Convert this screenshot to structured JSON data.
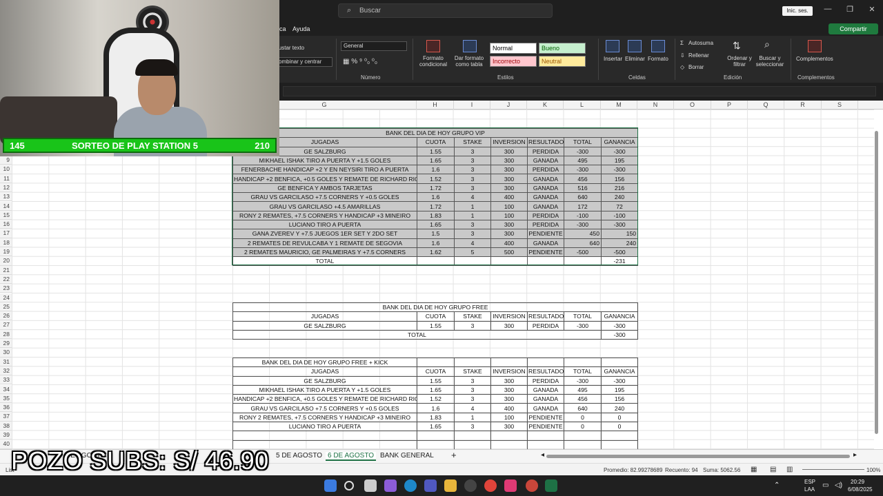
{
  "titlebar": {
    "search_placeholder": "Buscar",
    "signin": "Inic. ses."
  },
  "menu": {
    "partial": "ca",
    "help": "Ayuda",
    "share": "Compartir"
  },
  "ribbon": {
    "adjust_text": "justar texto",
    "merge": "ombinar y centrar",
    "number_format": "General",
    "group_number": "Número",
    "cond_format": "Formato\ncondicional",
    "format_table": "Dar formato\ncomo tabla",
    "styles": {
      "normal": "Normal",
      "good": "Bueno",
      "bad": "Incorrecto",
      "neutral": "Neutral"
    },
    "group_styles": "Estilos",
    "insert": "Insertar",
    "delete": "Eliminar",
    "format": "Formato",
    "group_cells": "Celdas",
    "autosum": "Autosuma",
    "fill": "Rellenar",
    "clear": "Borrar",
    "sort": "Ordenar y filtrar",
    "find": "Buscar y seleccionar",
    "group_edit": "Edición",
    "addins": "Complementos",
    "group_addins": "Complementos"
  },
  "columns": [
    "G",
    "H",
    "I",
    "J",
    "K",
    "L",
    "M",
    "N",
    "O",
    "P",
    "Q",
    "R",
    "S"
  ],
  "rows": [
    "9",
    "10",
    "11",
    "12",
    "13",
    "14",
    "15",
    "16",
    "17",
    "18",
    "19",
    "20",
    "21",
    "22",
    "23",
    "24",
    "25",
    "26",
    "27",
    "28",
    "29",
    "30",
    "31",
    "32",
    "33",
    "34",
    "35",
    "36",
    "37",
    "38",
    "39",
    "40"
  ],
  "vip": {
    "title": "BANK DEL DIA DE HOY GRUPO VIP",
    "headers": [
      "JUGADAS",
      "CUOTA",
      "STAKE",
      "INVERSION",
      "RESULTADO",
      "TOTAL",
      "GANANCIA"
    ],
    "rows": [
      [
        "GE SALZBURG",
        "1.55",
        "3",
        "300",
        "PERDIDA",
        "-300",
        "-300"
      ],
      [
        "MIKHAEL ISHAK TIRO A PUERTA Y +1.5 GOLES",
        "1.65",
        "3",
        "300",
        "GANADA",
        "495",
        "195"
      ],
      [
        "FENERBACHE HANDICAP +2 Y EN NEYSIRI TIRO A PUERTA",
        "1.6",
        "3",
        "300",
        "PERDIDA",
        "-300",
        "-300"
      ],
      [
        "HANDICAP +2 BENFICA, +0.5 GOLES Y REMATE DE RICHARD RIOS",
        "1.52",
        "3",
        "300",
        "GANADA",
        "456",
        "156"
      ],
      [
        "GE BENFICA Y AMBOS TARJETAS",
        "1.72",
        "3",
        "300",
        "GANADA",
        "516",
        "216"
      ],
      [
        "GRAU VS GARCILASO +7.5 CORNERS Y +0.5 GOLES",
        "1.6",
        "4",
        "400",
        "GANADA",
        "640",
        "240"
      ],
      [
        "GRAU VS GARCILASO +4.5 AMARILLAS",
        "1.72",
        "1",
        "100",
        "GANADA",
        "172",
        "72"
      ],
      [
        "RONY 2 REMATES, +7.5 CORNERS Y HANDICAP +3 MINEIRO",
        "1.83",
        "1",
        "100",
        "PERDIDA",
        "-100",
        "-100"
      ],
      [
        "LUCIANO TIRO A PUERTA",
        "1.65",
        "3",
        "300",
        "PERDIDA",
        "-300",
        "-300"
      ],
      [
        "GANA ZVEREV Y +7.5 JUEGOS 1ER SET Y 2DO SET",
        "1.5",
        "3",
        "300",
        "PENDIENTE",
        "450",
        "150"
      ],
      [
        "2 REMATES DE REVULCABA Y 1 REMATE DE SEGOVIA",
        "1.6",
        "4",
        "400",
        "GANADA",
        "640",
        "240"
      ],
      [
        "2 REMATES MAURICIO, GE PALMEIRAS Y +7.5 CORNERS",
        "1.62",
        "5",
        "500",
        "PENDIENTE",
        "-500",
        "-500"
      ]
    ],
    "total_label": "TOTAL",
    "total_value": "-231"
  },
  "free": {
    "title": "BANK DEL DIA DE HOY GRUPO FREE",
    "headers": [
      "JUGADAS",
      "CUOTA",
      "STAKE",
      "INVERSION",
      "RESULTADO",
      "TOTAL",
      "GANANCIA"
    ],
    "rows": [
      [
        "GE SALZBURG",
        "1.55",
        "3",
        "300",
        "PERDIDA",
        "-300",
        "-300"
      ]
    ],
    "total_label": "TOTAL",
    "total_value": "-300"
  },
  "kick": {
    "title": "BANK DEL DIA DE HOY GRUPO FREE + KICK",
    "headers": [
      "JUGADAS",
      "CUOTA",
      "STAKE",
      "INVERSION",
      "RESULTADO",
      "TOTAL",
      "GANANCIA"
    ],
    "rows": [
      [
        "GE SALZBURG",
        "1.55",
        "3",
        "300",
        "PERDIDA",
        "-300",
        "-300"
      ],
      [
        "MIKHAEL ISHAK TIRO A PUERTA Y +1.5 GOLES",
        "1.65",
        "3",
        "300",
        "GANADA",
        "495",
        "195"
      ],
      [
        "HANDICAP +2 BENFICA, +0.5 GOLES Y REMATE DE RICHARD RIOS",
        "1.52",
        "3",
        "300",
        "GANADA",
        "456",
        "156"
      ],
      [
        "GRAU VS GARCILASO +7.5 CORNERS Y +0.5 GOLES",
        "1.6",
        "4",
        "400",
        "GANADA",
        "640",
        "240"
      ],
      [
        "RONY 2 REMATES, +7.5 CORNERS Y HANDICAP +3 MINEIRO",
        "1.83",
        "1",
        "100",
        "PENDIENTE",
        "0",
        "0"
      ],
      [
        "LUCIANO TIRO A PUERTA",
        "1.65",
        "3",
        "300",
        "PENDIENTE",
        "0",
        "0"
      ]
    ]
  },
  "sheets": {
    "t1": "DE AGOSTO",
    "t2": "5 DE AGOSTO",
    "t3": "6 DE AGOSTO",
    "t4": "BANK GENERAL",
    "add": "+"
  },
  "status": {
    "ready": "List",
    "average": "Promedio: 82.99278689",
    "count": "Recuento: 94",
    "sum": "Suma: 5062.56",
    "zoom": "100%"
  },
  "taskbar": {
    "lang1": "ESP",
    "lang2": "LAA",
    "time": "20:29",
    "date": "6/08/2025"
  },
  "overlay": {
    "left_num": "145",
    "title": "SORTEO DE PLAY STATION 5",
    "right_num": "210",
    "pozo": "POZO SUBS: S/ 46.90"
  },
  "colors": {
    "excel_green": "#1e7145",
    "banner_green": "#19c419"
  }
}
